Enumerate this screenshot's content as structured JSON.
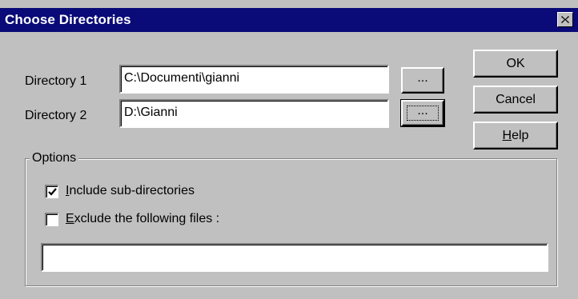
{
  "window": {
    "title": "Choose Directories",
    "close_glyph": "✕"
  },
  "directories": [
    {
      "label": "Directory 1",
      "value": "C:\\Documenti\\gianni",
      "browse_label": "..."
    },
    {
      "label": "Directory 2",
      "value": "D:\\Gianni",
      "browse_label": "..."
    }
  ],
  "buttons": {
    "ok": "OK",
    "cancel": "Cancel",
    "help_mnemonic": "H",
    "help_rest": "elp"
  },
  "options": {
    "title": "Options",
    "include_sub": {
      "mnemonic": "I",
      "rest": "nclude sub-directories",
      "checked": true
    },
    "exclude_files": {
      "mnemonic": "E",
      "rest": "xclude the following files :",
      "checked": false
    },
    "exclude_pattern": ""
  },
  "colors": {
    "titlebar": "#0a0a78",
    "face": "#c0c0c0"
  }
}
